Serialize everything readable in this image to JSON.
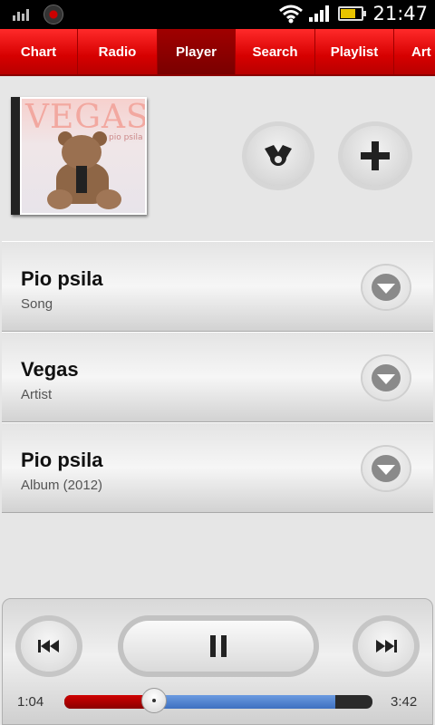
{
  "status_bar": {
    "time": "21:47",
    "icons": [
      "stats-icon",
      "music-disc-icon",
      "wifi-icon",
      "signal-icon",
      "battery-icon"
    ],
    "battery_level": 0.65
  },
  "tabs": [
    {
      "label": "Chart",
      "active": false
    },
    {
      "label": "Radio",
      "active": false
    },
    {
      "label": "Player",
      "active": true
    },
    {
      "label": "Search",
      "active": false
    },
    {
      "label": "Playlist",
      "active": false
    },
    {
      "label": "Art",
      "active": false
    }
  ],
  "album": {
    "cover_text": "VEGAS",
    "cover_subtext": "pio psila"
  },
  "actions": {
    "share_icon": "share-icon",
    "add_icon": "plus-icon"
  },
  "track_info": [
    {
      "title": "Pio psila",
      "subtitle": "Song",
      "icon": "chevron-down-icon"
    },
    {
      "title": "Vegas",
      "subtitle": "Artist",
      "icon": "chevron-down-icon"
    },
    {
      "title": "Pio psila",
      "subtitle": "Album (2012)",
      "icon": "chevron-down-icon"
    }
  ],
  "player": {
    "current_time": "1:04",
    "total_time": "3:42",
    "progress_fraction": 0.29,
    "buffered_fraction": 0.88,
    "prev_icon": "skip-previous-icon",
    "pause_icon": "pause-icon",
    "next_icon": "skip-next-icon"
  },
  "colors": {
    "accent": "#d60000",
    "tab_active": "#8a0000",
    "buffer": "#4a7ed0"
  }
}
